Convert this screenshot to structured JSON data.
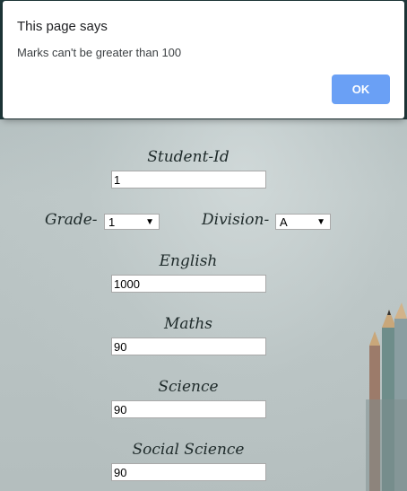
{
  "dialog": {
    "title": "This page says",
    "message": "Marks can't be greater than 100",
    "ok_label": "OK"
  },
  "form": {
    "student_id": {
      "label": "Student-Id",
      "value": "1"
    },
    "grade": {
      "label": "Grade-",
      "selected": "1"
    },
    "division": {
      "label": "Division-",
      "selected": "A"
    },
    "english": {
      "label": "English",
      "value": "1000"
    },
    "maths": {
      "label": "Maths",
      "value": "90"
    },
    "science": {
      "label": "Science",
      "value": "90"
    },
    "social_science": {
      "label": "Social Science",
      "value": "90"
    }
  },
  "icons": {
    "select_caret": "caret-down-icon"
  }
}
